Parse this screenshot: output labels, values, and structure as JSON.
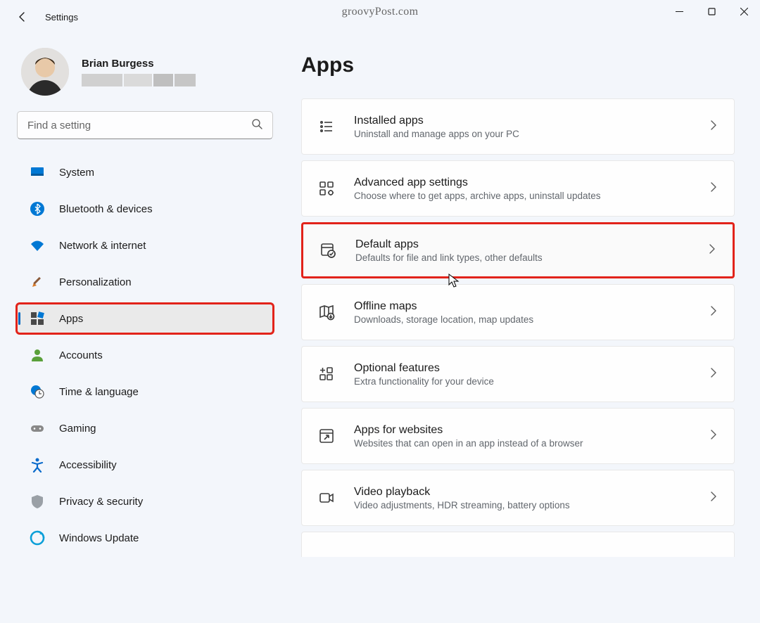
{
  "window_title": "Settings",
  "watermark": "groovyPost.com",
  "user": {
    "name": "Brian Burgess"
  },
  "search": {
    "placeholder": "Find a setting"
  },
  "nav": [
    {
      "id": "system",
      "label": "System"
    },
    {
      "id": "bluetooth",
      "label": "Bluetooth & devices"
    },
    {
      "id": "network",
      "label": "Network & internet"
    },
    {
      "id": "personalization",
      "label": "Personalization"
    },
    {
      "id": "apps",
      "label": "Apps",
      "active": true,
      "highlighted": true
    },
    {
      "id": "accounts",
      "label": "Accounts"
    },
    {
      "id": "time",
      "label": "Time & language"
    },
    {
      "id": "gaming",
      "label": "Gaming"
    },
    {
      "id": "accessibility",
      "label": "Accessibility"
    },
    {
      "id": "privacy",
      "label": "Privacy & security"
    },
    {
      "id": "update",
      "label": "Windows Update"
    }
  ],
  "page": {
    "title": "Apps"
  },
  "cards": [
    {
      "id": "installed",
      "title": "Installed apps",
      "desc": "Uninstall and manage apps on your PC"
    },
    {
      "id": "advanced",
      "title": "Advanced app settings",
      "desc": "Choose where to get apps, archive apps, uninstall updates"
    },
    {
      "id": "default",
      "title": "Default apps",
      "desc": "Defaults for file and link types, other defaults",
      "highlighted": true
    },
    {
      "id": "offline",
      "title": "Offline maps",
      "desc": "Downloads, storage location, map updates"
    },
    {
      "id": "optional",
      "title": "Optional features",
      "desc": "Extra functionality for your device"
    },
    {
      "id": "websites",
      "title": "Apps for websites",
      "desc": "Websites that can open in an app instead of a browser"
    },
    {
      "id": "video",
      "title": "Video playback",
      "desc": "Video adjustments, HDR streaming, battery options"
    },
    {
      "id": "startup_cut",
      "title": "",
      "desc": "",
      "cut": true
    }
  ]
}
